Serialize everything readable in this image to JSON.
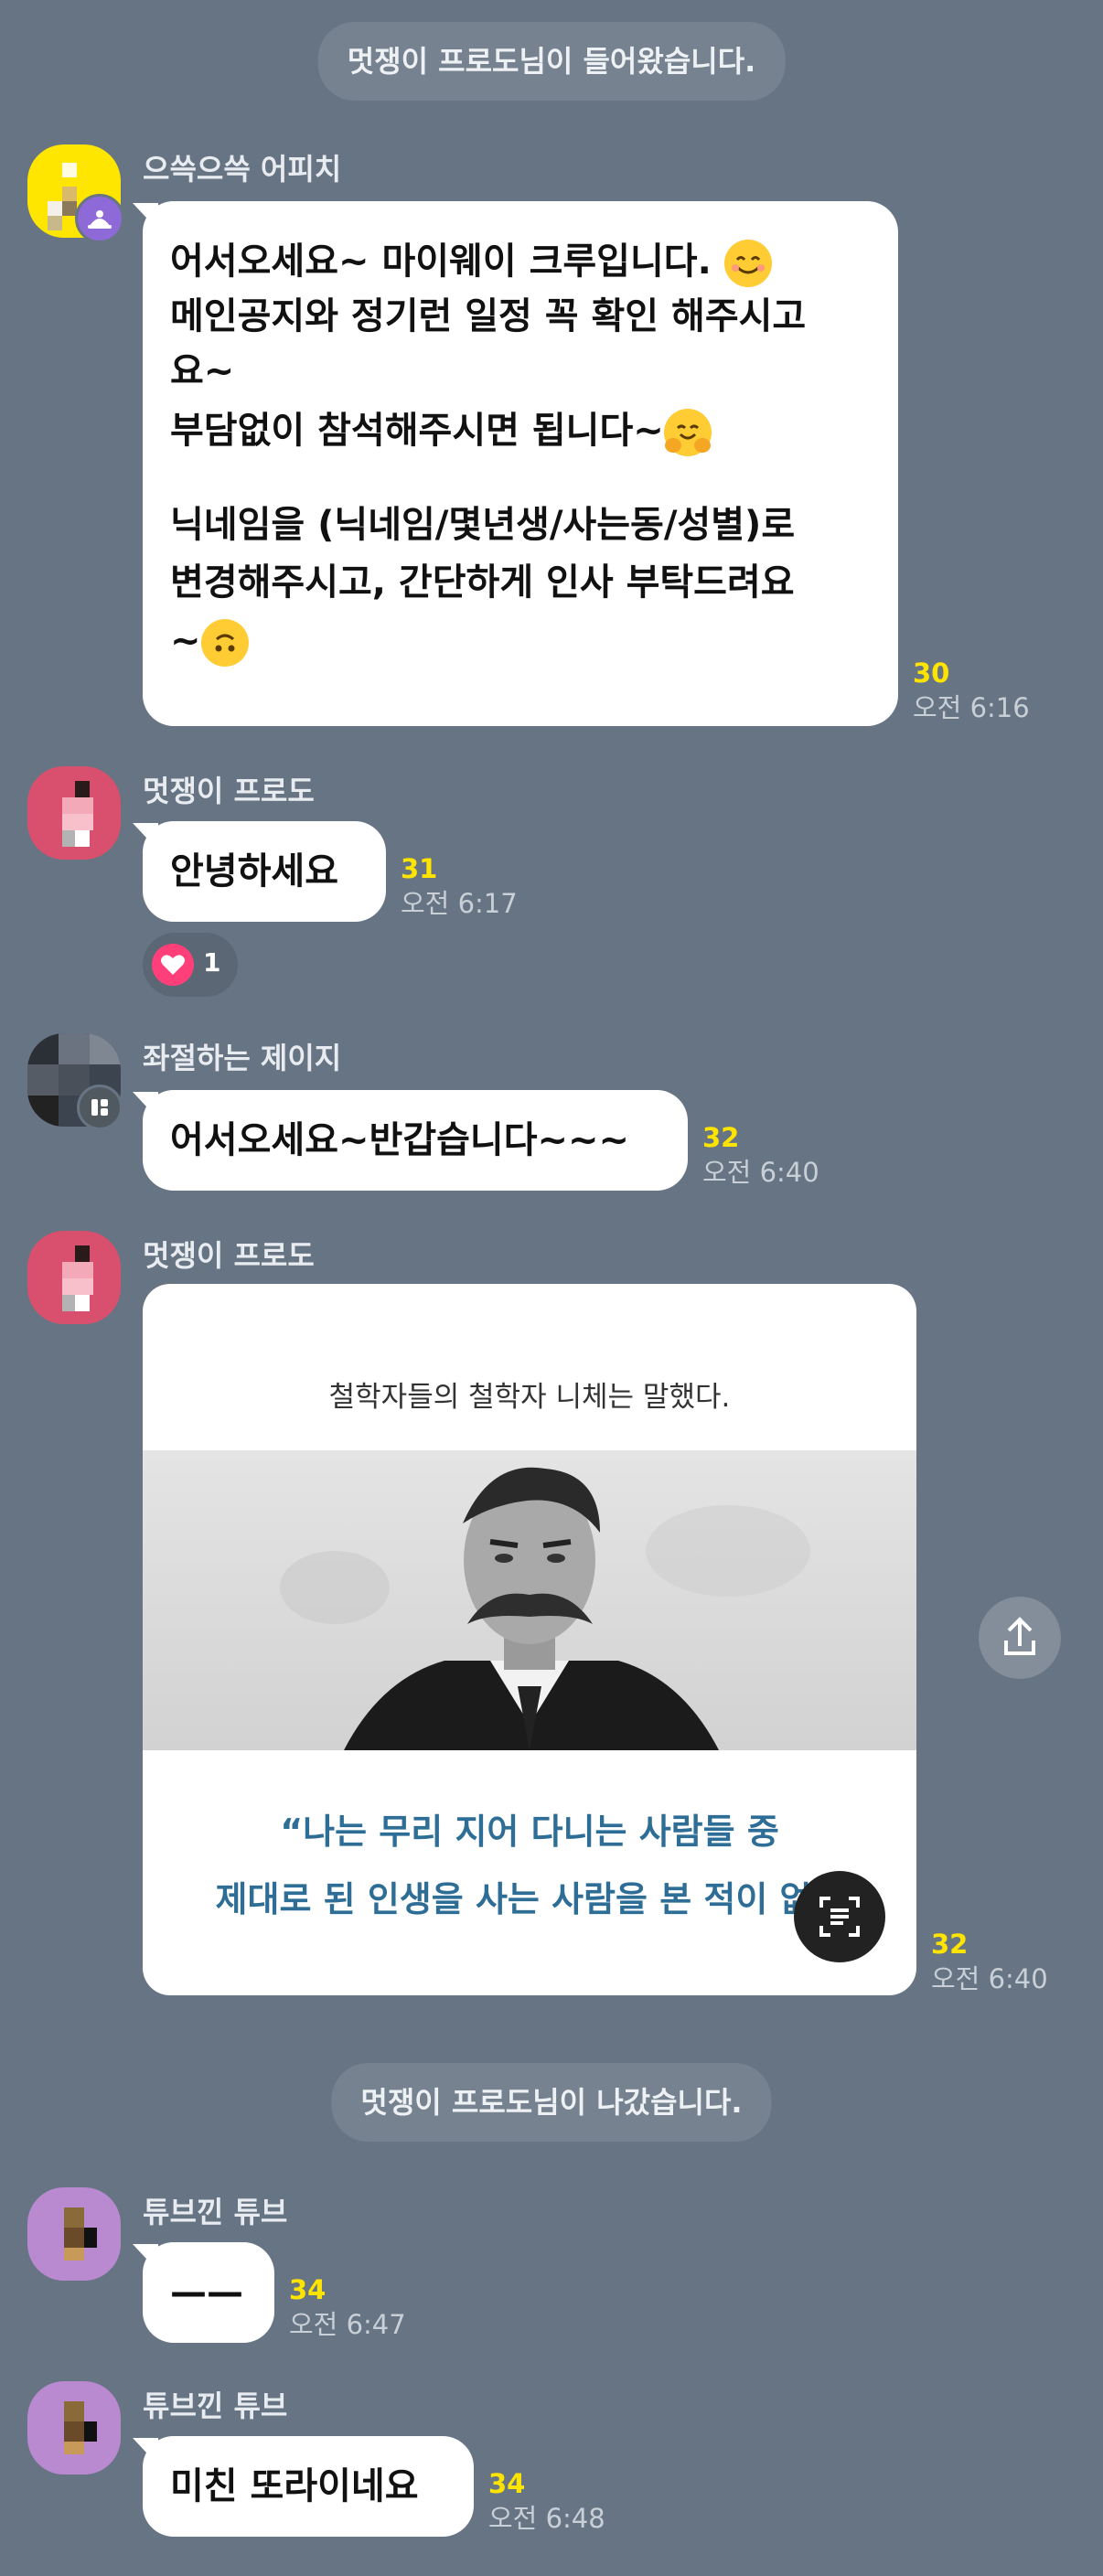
{
  "system": {
    "joined": "멋쟁이 프로도님이 들어왔습니다.",
    "left": "멋쟁이 프로도님이 나갔습니다."
  },
  "messages": {
    "m1": {
      "sender": "으쓱으쓱 어피치",
      "lines": [
        "어서오세요~ 마이웨이 크루입니다.",
        "메인공지와 정기런 일정 꼭 확인 해주시고",
        "요~",
        "부담없이 참석해주시면 됩니다~",
        "",
        "닉네임을 (닉네임/몇년생/사는동/성별)로",
        "변경해주시고, 간단하게 인사 부탁드려요",
        "~"
      ],
      "count": "30",
      "time": "오전 6:16"
    },
    "m2": {
      "sender": "멋쟁이 프로도",
      "text": "안녕하세요",
      "count": "31",
      "time": "오전 6:17",
      "reaction_count": "1"
    },
    "m3": {
      "sender": "좌절하는 제이지",
      "text": "어서오세요~반갑습니다~~~",
      "count": "32",
      "time": "오전 6:40"
    },
    "m4": {
      "sender": "멋쟁이 프로도",
      "image_caption": "철학자들의 철학자 니체는 말했다.",
      "image_quote_1": "“나는 무리 지어 다니는 사람들 중",
      "image_quote_2": "제대로 된 인생을 사는 사람을 본 적이 없다",
      "count": "32",
      "time": "오전 6:40"
    },
    "m5": {
      "sender": "튜브낀 튜브",
      "text": "——",
      "count": "34",
      "time": "오전 6:47"
    },
    "m6": {
      "sender": "튜브낀 튜브",
      "text": "미친 또라이네요",
      "count": "34",
      "time": "오전 6:48"
    }
  },
  "colors": {
    "background": "#677483",
    "unread_count": "#ffe400",
    "bubble": "#ffffff",
    "system_pill": "#76828f"
  },
  "icons": [
    "share-icon",
    "text-scan-icon",
    "heart-icon",
    "bot-badge-icon",
    "device-badge-icon"
  ]
}
